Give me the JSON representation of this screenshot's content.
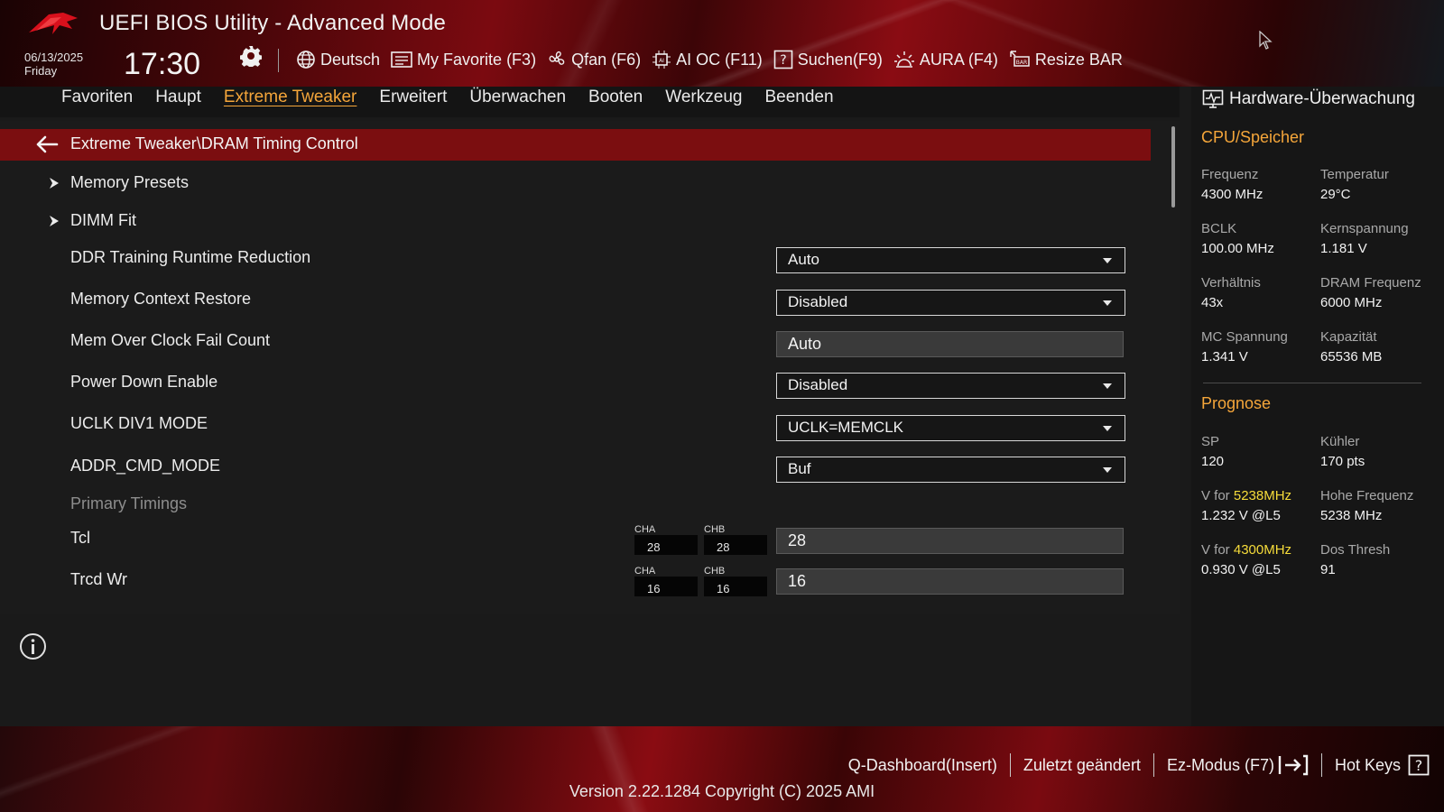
{
  "header": {
    "title": "UEFI BIOS Utility - Advanced Mode",
    "date": "06/13/2025",
    "weekday": "Friday",
    "time": "17:30",
    "tools": [
      {
        "label": "Deutsch",
        "icon": "globe-icon"
      },
      {
        "label": "My Favorite (F3)",
        "icon": "favorite-list-icon"
      },
      {
        "label": "Qfan (F6)",
        "icon": "fan-icon"
      },
      {
        "label": "AI OC (F11)",
        "icon": "ai-chip-icon"
      },
      {
        "label": "Suchen(F9)",
        "icon": "search-question-icon"
      },
      {
        "label": "AURA (F4)",
        "icon": "aura-light-icon"
      },
      {
        "label": "Resize BAR",
        "icon": "resize-bar-icon"
      }
    ]
  },
  "tabs": [
    "Favoriten",
    "Haupt",
    "Extreme Tweaker",
    "Erweitert",
    "Überwachen",
    "Booten",
    "Werkzeug",
    "Beenden"
  ],
  "active_tab": "Extreme Tweaker",
  "main": {
    "breadcrumb": "Extreme Tweaker\\DRAM Timing Control",
    "submenus": [
      "Memory Presets",
      "DIMM Fit"
    ],
    "settings": [
      {
        "label": "DDR Training Runtime Reduction",
        "value": "Auto",
        "kind": "dropdown"
      },
      {
        "label": "Memory Context Restore",
        "value": "Disabled",
        "kind": "dropdown"
      },
      {
        "label": "Mem Over Clock Fail Count",
        "value": "Auto",
        "kind": "field"
      },
      {
        "label": "Power Down Enable",
        "value": "Disabled",
        "kind": "dropdown"
      },
      {
        "label": "UCLK DIV1 MODE",
        "value": "UCLK=MEMCLK",
        "kind": "dropdown"
      },
      {
        "label": "ADDR_CMD_MODE",
        "value": "Buf",
        "kind": "dropdown"
      }
    ],
    "section": "Primary Timings",
    "timings": [
      {
        "label": "Tcl",
        "cha_label": "CHA",
        "cha": "28",
        "chb_label": "CHB",
        "chb": "28",
        "value": "28"
      },
      {
        "label": "Trcd Wr",
        "cha_label": "CHA",
        "cha": "16",
        "chb_label": "CHB",
        "chb": "16",
        "value": "16"
      }
    ]
  },
  "hw_monitor": {
    "title": "Hardware-Überwachung",
    "cpu_section": "CPU/Speicher",
    "cpu": [
      {
        "label": "Frequenz",
        "value": "4300 MHz"
      },
      {
        "label": "Temperatur",
        "value": "29°C"
      },
      {
        "label": "BCLK",
        "value": "100.00 MHz"
      },
      {
        "label": "Kernspannung",
        "value": "1.181 V"
      },
      {
        "label": "Verhältnis",
        "value": "43x"
      },
      {
        "label": "DRAM Frequenz",
        "value": "6000 MHz"
      },
      {
        "label": "MC Spannung",
        "value": "1.341 V"
      },
      {
        "label": "Kapazität",
        "value": "65536 MB"
      }
    ],
    "prognose_section": "Prognose",
    "prognose": {
      "sp_label": "SP",
      "sp_value": "120",
      "cooler_label": "Kühler",
      "cooler_value": "170 pts",
      "v1_prefix": "V for ",
      "v1_freq": "5238MHz",
      "v1_value": "1.232 V @L5",
      "high_label": "Hohe Frequenz",
      "high_value": "5238 MHz",
      "v2_prefix": "V for ",
      "v2_freq": "4300MHz",
      "v2_value": "0.930 V @L5",
      "dos_label": "Dos Thresh",
      "dos_value": "91"
    }
  },
  "footer": {
    "qdashboard": "Q-Dashboard(Insert)",
    "last_changed": "Zuletzt geändert",
    "ez_mode": "Ez-Modus (F7)",
    "hot_keys": "Hot Keys",
    "version": "Version 2.22.1284 Copyright (C) 2025 AMI"
  },
  "colors": {
    "accent": "#f5a63a",
    "highlight_yellow": "#f6dc3a",
    "breadcrumb_bar": "#7b0e10"
  }
}
